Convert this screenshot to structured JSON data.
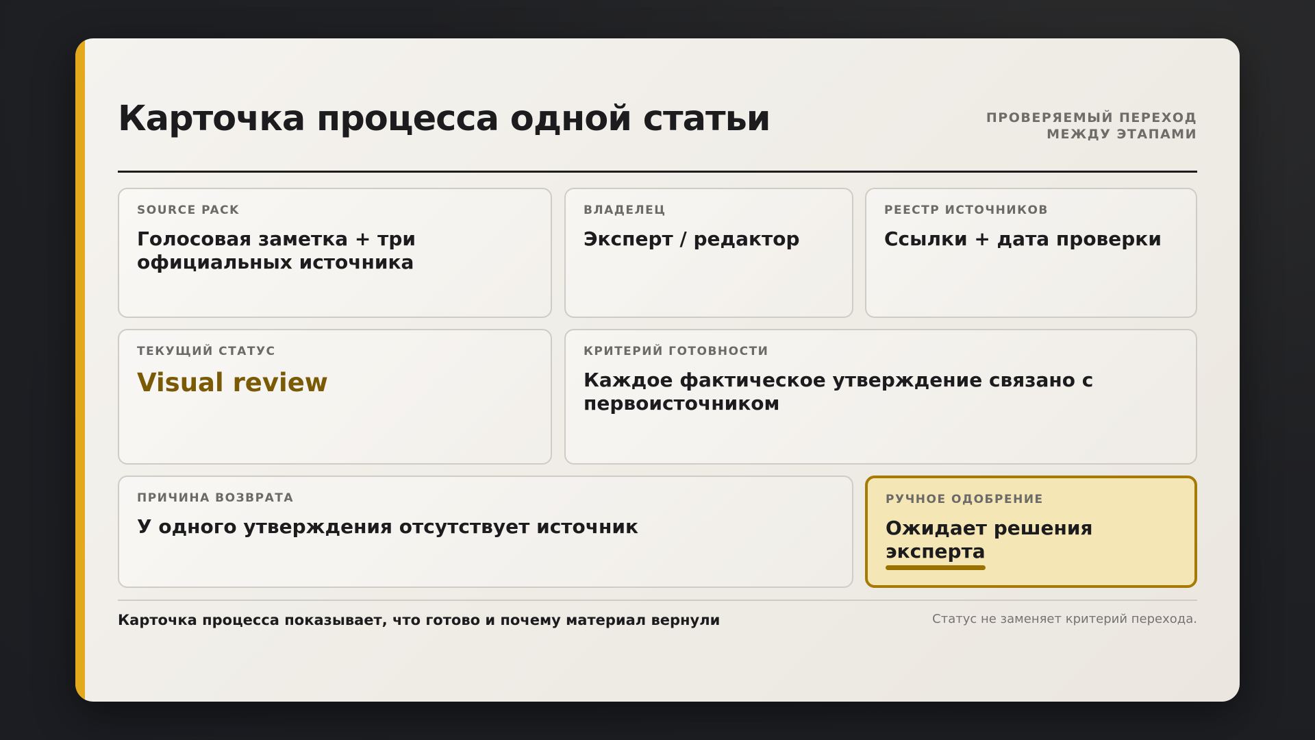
{
  "header": {
    "title": "Карточка процесса одной статьи",
    "subtitle": "ПРОВЕРЯЕМЫЙ ПЕРЕХОД МЕЖДУ ЭТАПАМИ"
  },
  "cards": {
    "source_pack": {
      "label": "SOURCE PACK",
      "value": "Голосовая заметка + три официальных источника"
    },
    "owner": {
      "label": "ВЛАДЕЛЕЦ",
      "value": "Эксперт / редактор"
    },
    "source_registry": {
      "label": "РЕЕСТР ИСТОЧНИКОВ",
      "value": "Ссылки + дата проверки"
    },
    "current_status": {
      "label": "ТЕКУЩИЙ СТАТУС",
      "value": "Visual review"
    },
    "readiness_criterion": {
      "label": "КРИТЕРИЙ ГОТОВНОСТИ",
      "value": "Каждое фактическое утверждение связано с первоисточником"
    },
    "return_reason": {
      "label": "ПРИЧИНА ВОЗВРАТА",
      "value": "У одного утверждения отсутствует источник"
    },
    "manual_approval": {
      "label": "РУЧНОЕ ОДОБРЕНИЕ",
      "value": "Ожидает решения эксперта",
      "progress_fraction": 0.35
    }
  },
  "footer": {
    "left": "Карточка процесса показывает, что готово и почему материал вернули",
    "right": "Статус не заменяет критерий перехода."
  },
  "colors": {
    "accent": "#e2a91c",
    "status_text": "#7a5a05",
    "highlight_background": "#f4e7b5",
    "highlight_border": "#a57b06"
  }
}
